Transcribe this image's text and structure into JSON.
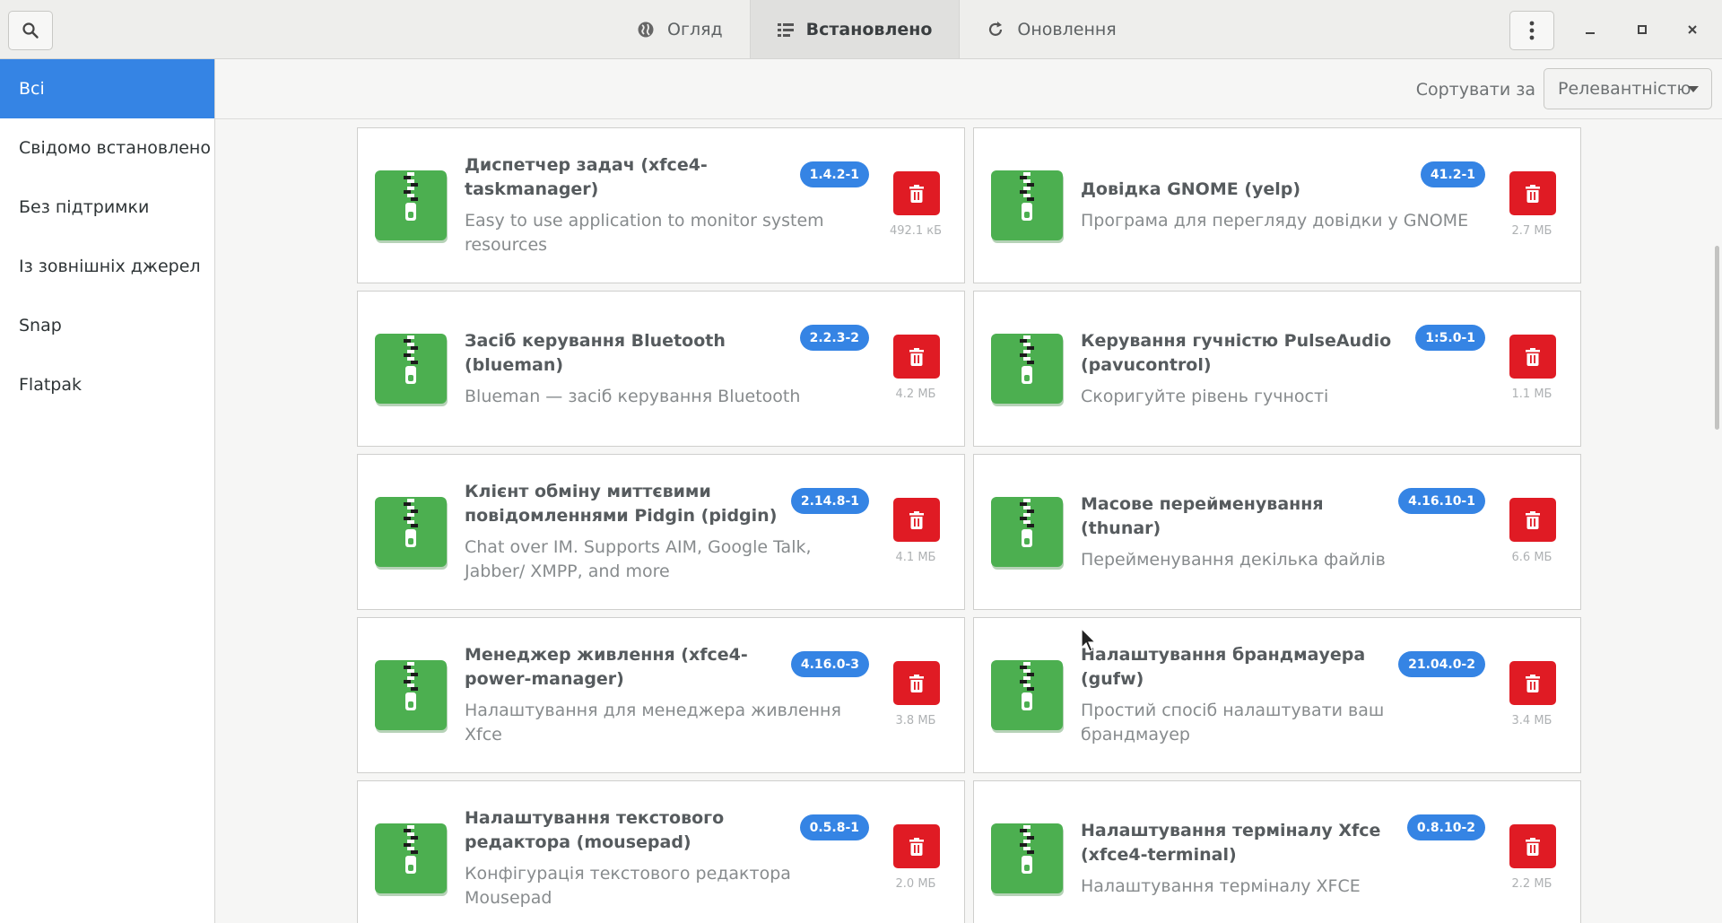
{
  "header": {
    "tabs": [
      {
        "label": "Огляд",
        "icon": "globe-icon"
      },
      {
        "label": "Встановлено",
        "icon": "list-icon"
      },
      {
        "label": "Оновлення",
        "icon": "refresh-icon"
      }
    ],
    "active_tab": 1
  },
  "sidebar": {
    "items": [
      {
        "label": "Всі"
      },
      {
        "label": "Свідомо встановлено"
      },
      {
        "label": "Без підтримки"
      },
      {
        "label": "Із зовнішніх джерел"
      },
      {
        "label": "Snap"
      },
      {
        "label": "Flatpak"
      }
    ],
    "active_index": 0
  },
  "sort": {
    "label": "Сортувати за",
    "value": "Релевантністю"
  },
  "apps": [
    {
      "name": "Диспетчер задач (xfce4-taskmanager)",
      "description": "Easy to use application to monitor system resources",
      "version": "1.4.2-1",
      "size": "492.1 кБ"
    },
    {
      "name": "Довідка GNOME (yelp)",
      "description": "Програма для перегляду довідки у GNOME",
      "version": "41.2-1",
      "size": "2.7 МБ"
    },
    {
      "name": "Засіб керування Bluetooth (blueman)",
      "description": "Blueman — засіб керування Bluetooth",
      "version": "2.2.3-2",
      "size": "4.2 МБ"
    },
    {
      "name": "Керування гучністю PulseAudio (pavucontrol)",
      "description": "Скоригуйте рівень гучності",
      "version": "1:5.0-1",
      "size": "1.1 МБ"
    },
    {
      "name": "Клієнт обміну миттєвими повідомленнями Pidgin (pidgin)",
      "description": "Chat over IM.  Supports AIM, Google Talk, Jabber/ XMPP, and more",
      "version": "2.14.8-1",
      "size": "4.1 МБ"
    },
    {
      "name": "Масове перейменування (thunar)",
      "description": "Перейменування декілька файлів",
      "version": "4.16.10-1",
      "size": "6.6 МБ"
    },
    {
      "name": "Менеджер живлення (xfce4-power-manager)",
      "description": "Налаштування для менеджера живлення Xfce",
      "version": "4.16.0-3",
      "size": "3.8 МБ"
    },
    {
      "name": "Налаштування брандмауера (gufw)",
      "description": "Простий спосіб налаштувати ваш брандмауер",
      "version": "21.04.0-2",
      "size": "3.4 МБ"
    },
    {
      "name": "Налаштування текстового редактора (mousepad)",
      "description": "Конфігурація текстового редактора Mousepad",
      "version": "0.5.8-1",
      "size": "2.0 МБ"
    },
    {
      "name": "Налаштування терміналу Xfce (xfce4-terminal)",
      "description": "Налаштування терміналу XFCE",
      "version": "0.8.10-2",
      "size": "2.2 МБ"
    }
  ],
  "colors": {
    "accent": "#3584e4",
    "delete": "#e01b24",
    "icon_green": "#4caf50"
  }
}
